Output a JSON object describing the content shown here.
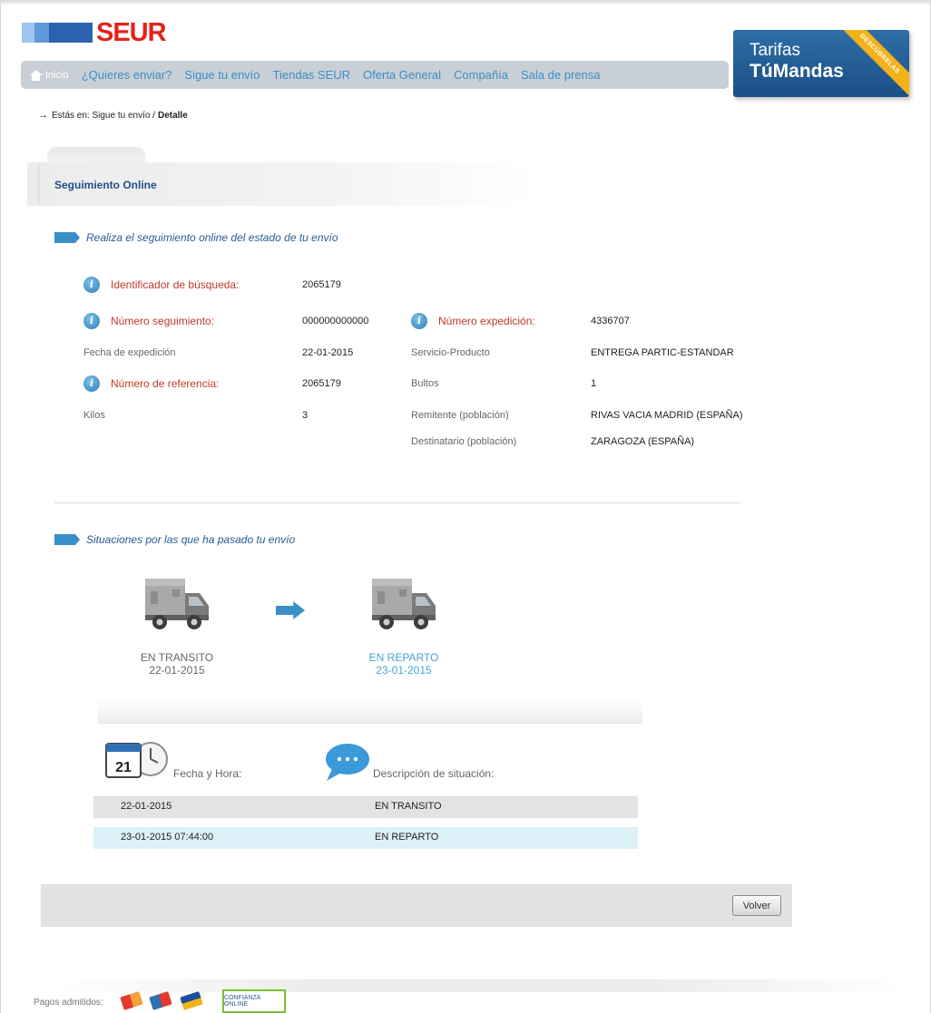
{
  "brand": {
    "name": "SEUR"
  },
  "nav": {
    "home_label": "Inicio",
    "items": [
      "¿Quieres enviar?",
      "Sigue tu envío",
      "Tiendas SEUR",
      "Oferta General",
      "Compañía",
      "Sala de prensa"
    ]
  },
  "banner": {
    "line1": "Tarifas",
    "line2": "TúMandas",
    "corner": "DESCÚBRELAS"
  },
  "breadcrumb": {
    "prefix": "Estás en: Sigue tu envío /",
    "current": "Detalle"
  },
  "panel": {
    "title": "Seguimiento Online"
  },
  "section1": {
    "title": "Realiza el seguimiento online del estado de tu envío"
  },
  "fields": {
    "identificador_label": "Identificador de búsqueda:",
    "identificador_value": "2065179",
    "num_seguimiento_label": "Número seguimiento:",
    "num_seguimiento_value": "000000000000",
    "num_expedicion_label": "Número expedición:",
    "num_expedicion_value": "4336707",
    "fecha_label": "Fecha de expedición",
    "fecha_value": "22-01-2015",
    "servicio_label": "Servicio-Producto",
    "servicio_value": "ENTREGA PARTIC-ESTANDAR",
    "referencia_label": "Número de referencia:",
    "referencia_value": "2065179",
    "bultos_label": "Bultos",
    "bultos_value": "1",
    "kilos_label": "Kilos",
    "kilos_value": "3",
    "remitente_label": "Remitente (población)",
    "remitente_value": "RIVAS VACIA MADRID (ESPAÑA)",
    "destinatario_label": "Destinatario (población)",
    "destinatario_value": "ZARAGOZA (ESPAÑA)"
  },
  "section2": {
    "title": "Situaciones por las que ha pasado tu envío"
  },
  "flow": [
    {
      "status": "EN TRANSITO",
      "date": "22-01-2015",
      "color": "#666666"
    },
    {
      "status": "EN REPARTO",
      "date": "23-01-2015",
      "color": "#4aa3d6"
    }
  ],
  "history": {
    "calendar_day": "21",
    "col_date": "Fecha y Hora:",
    "col_desc": "Descripción de situación:",
    "rows": [
      {
        "date": "22-01-2015",
        "desc": "EN TRANSITO",
        "bg": "#e3e3e3"
      },
      {
        "date": "23-01-2015 07:44:00",
        "desc": "EN REPARTO",
        "bg": "#dcf0f7"
      }
    ]
  },
  "actions": {
    "volver": "Volver"
  },
  "footer": {
    "payments_label": "Pagos admitidos:",
    "trust_label": "CONFIANZA ONLINE"
  }
}
